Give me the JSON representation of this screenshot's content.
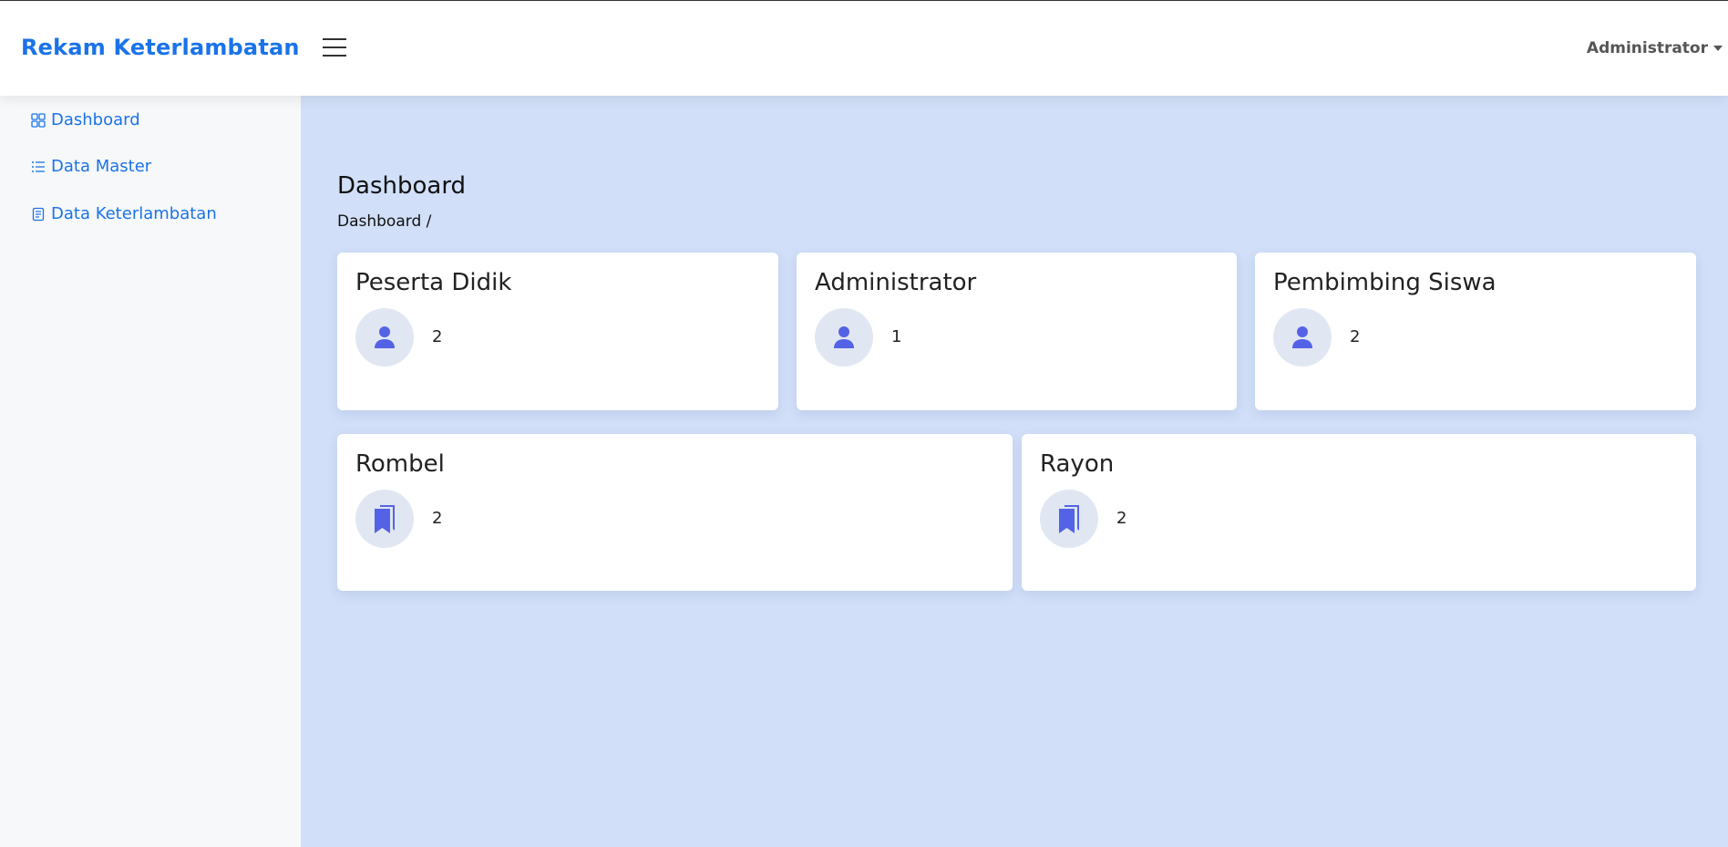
{
  "header": {
    "brand": "Rekam Keterlambatan",
    "user": "Administrator"
  },
  "sidebar": {
    "items": [
      {
        "label": "Dashboard",
        "icon": "grid-icon"
      },
      {
        "label": "Data Master",
        "icon": "list-icon"
      },
      {
        "label": "Data Keterlambatan",
        "icon": "document-icon"
      }
    ]
  },
  "main": {
    "title": "Dashboard",
    "breadcrumb": "Dashboard /",
    "cards": [
      {
        "title": "Peserta Didik",
        "value": "2",
        "icon": "person-icon"
      },
      {
        "title": "Administrator",
        "value": "1",
        "icon": "person-icon"
      },
      {
        "title": "Pembimbing Siswa",
        "value": "2",
        "icon": "person-icon"
      },
      {
        "title": "Rombel",
        "value": "2",
        "icon": "bookmark-icon"
      },
      {
        "title": "Rayon",
        "value": "2",
        "icon": "bookmark-icon"
      }
    ]
  },
  "colors": {
    "brand": "#1a73e8",
    "icon_accent": "#5463e6",
    "main_bg": "#d1dff8",
    "sidebar_bg": "#f7f8fa"
  }
}
